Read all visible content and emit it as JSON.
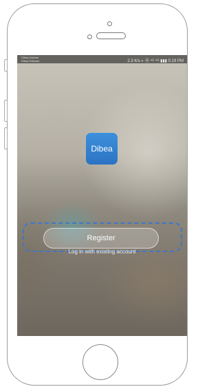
{
  "status_bar": {
    "carrier_line1": "China Unicom",
    "carrier_line2": "China Telecom",
    "right_text": "2.3 K/s ◐ ⦿ ⁴ᴳ ⁴ᴳ ▮▮▮ 5:19 PM"
  },
  "app": {
    "logo_text": "Dibea"
  },
  "buttons": {
    "register": "Register",
    "login_link": "Log in with existing account"
  }
}
